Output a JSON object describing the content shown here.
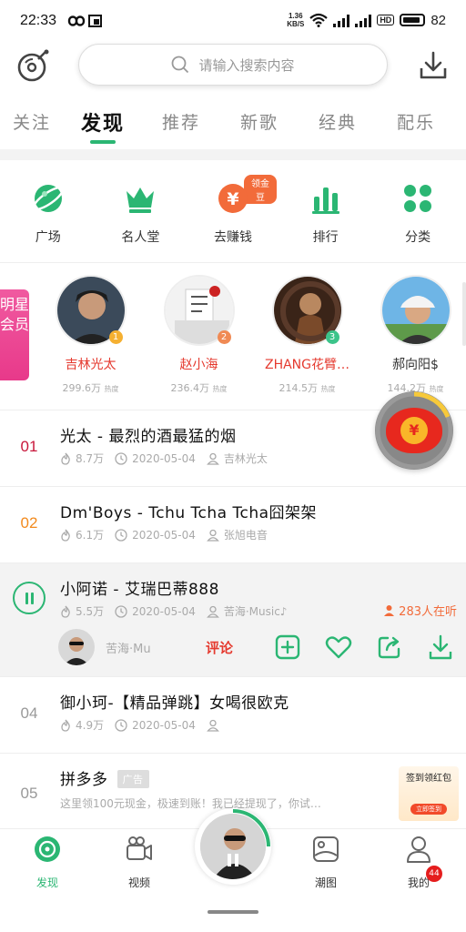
{
  "status_bar": {
    "time": "22:33",
    "speed_value": "1.36",
    "speed_unit": "KB/S",
    "battery": "82",
    "hd": "HD"
  },
  "search": {
    "placeholder": "请输入搜索内容"
  },
  "tabs": [
    {
      "label": "关注",
      "active": false
    },
    {
      "label": "发现",
      "active": true
    },
    {
      "label": "推荐",
      "active": false
    },
    {
      "label": "新歌",
      "active": false
    },
    {
      "label": "经典",
      "active": false
    },
    {
      "label": "配乐",
      "active": false
    }
  ],
  "quick_actions": [
    {
      "label": "广场",
      "icon": "planet-icon"
    },
    {
      "label": "名人堂",
      "icon": "crown-icon"
    },
    {
      "label": "去赚钱",
      "icon": "yen-coin-icon",
      "badge": "领金豆"
    },
    {
      "label": "排行",
      "icon": "bar-chart-icon"
    },
    {
      "label": "分类",
      "icon": "grid-icon"
    }
  ],
  "member_tag": "明星会员",
  "stars": [
    {
      "name": "吉林光太",
      "heat": "299.6万",
      "heat_unit": "热度",
      "rank": "1",
      "name_color": "#e53a2f",
      "rank_color": "#f5b031"
    },
    {
      "name": "赵小海",
      "heat": "236.4万",
      "heat_unit": "热度",
      "rank": "2",
      "name_color": "#e53a2f",
      "rank_color": "#f08a54"
    },
    {
      "name": "ZHANG花臂…",
      "heat": "214.5万",
      "heat_unit": "热度",
      "rank": "3",
      "name_color": "#e53a2f",
      "rank_color": "#3cc48a"
    },
    {
      "name": "郝向阳$",
      "heat": "144.2万",
      "heat_unit": "热度",
      "rank": "",
      "name_color": "#333333",
      "rank_color": ""
    }
  ],
  "songs": [
    {
      "num": "01",
      "num_color": "#c8173b",
      "title": "光太 - 最烈的酒最猛的烟",
      "plays": "8.7万",
      "date": "2020-05-04",
      "artist": "吉林光太"
    },
    {
      "num": "02",
      "num_color": "#f28a1d",
      "title": "Dm'Boys - Tchu Tcha Tcha囧架架",
      "plays": "6.1万",
      "date": "2020-05-04",
      "artist": "张旭电音"
    },
    {
      "num": "",
      "title": "小阿诺 - 艾瑞巴蒂888",
      "plays": "5.5万",
      "date": "2020-05-04",
      "artist": "苦海·Music♪",
      "listeners": "283人在听",
      "uploader": "苦海·Mu",
      "comment_label": "评论"
    },
    {
      "num": "04",
      "num_color": "#999999",
      "title": "御小珂-【精品弹跳】女喝很欧克",
      "plays": "4.9万",
      "date": "2020-05-04",
      "artist": ""
    }
  ],
  "ad": {
    "num": "05",
    "title": "拼多多",
    "tag": "广告",
    "desc": "这里领100元现金，极速到账！我已经提现了，你试…",
    "image_title": "签到领红包",
    "image_button": "立即签到"
  },
  "bottom_nav": [
    {
      "label": "发现",
      "icon": "discover-disc-icon",
      "active": true
    },
    {
      "label": "视频",
      "icon": "video-camera-icon",
      "active": false
    },
    {
      "label": "潮图",
      "icon": "picture-icon",
      "active": false
    },
    {
      "label": "我的",
      "icon": "profile-icon",
      "active": false,
      "badge": "44"
    }
  ],
  "colors": {
    "accent": "#2bb673",
    "red": "#e53a2f",
    "orange": "#f26b3a"
  }
}
